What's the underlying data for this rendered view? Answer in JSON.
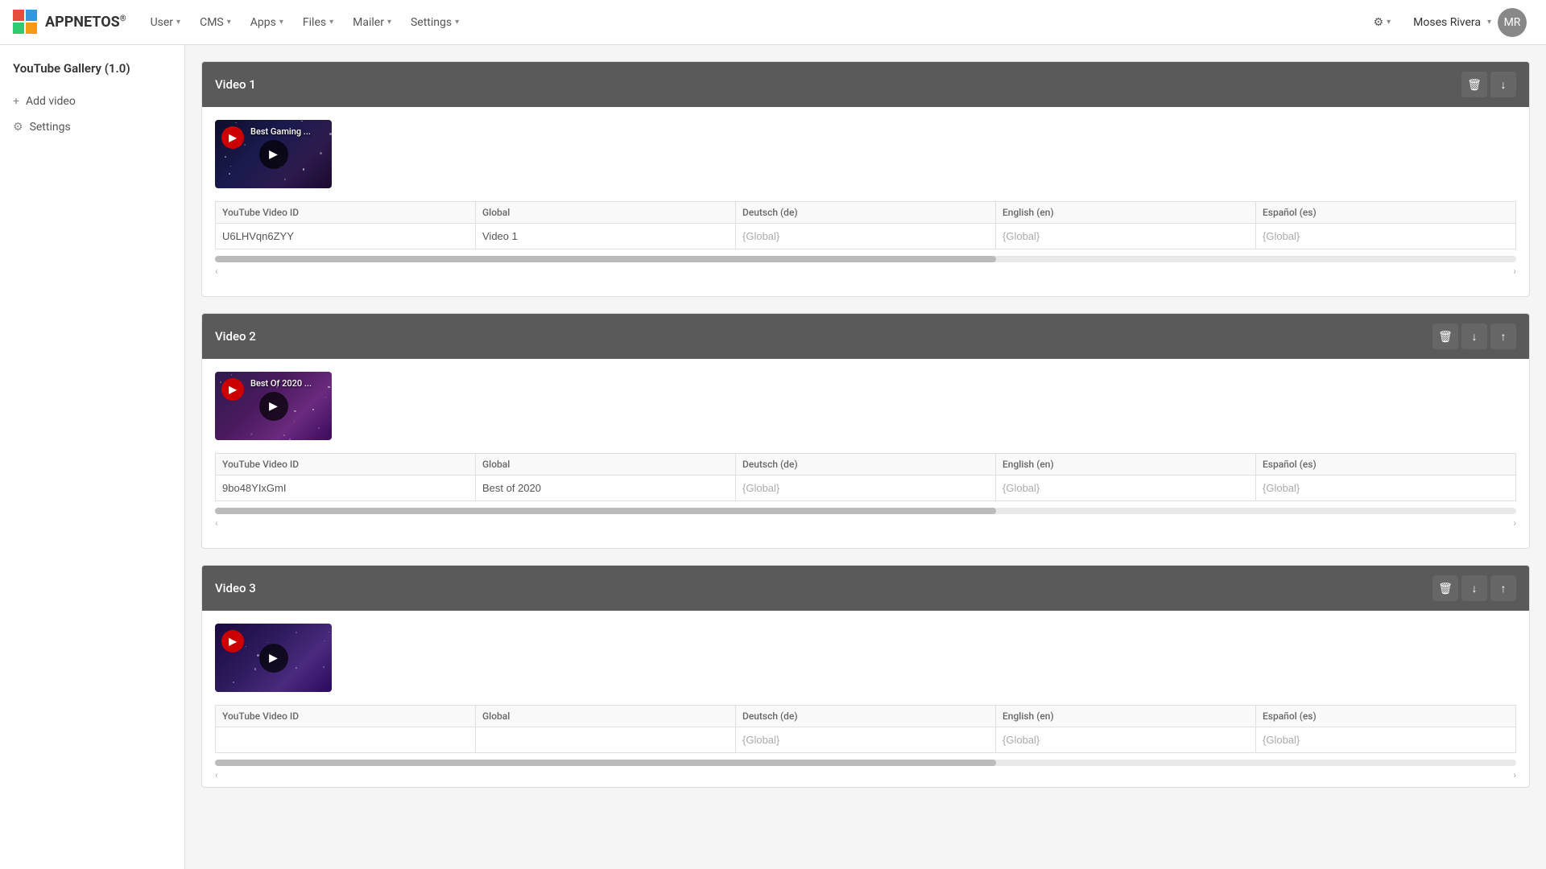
{
  "brand": {
    "name": "APPNETOS",
    "registered": "®"
  },
  "navbar": {
    "menu_items": [
      {
        "label": "User",
        "id": "user"
      },
      {
        "label": "CMS",
        "id": "cms"
      },
      {
        "label": "Apps",
        "id": "apps"
      },
      {
        "label": "Files",
        "id": "files"
      },
      {
        "label": "Mailer",
        "id": "mailer"
      },
      {
        "label": "Settings",
        "id": "settings"
      }
    ],
    "user_name": "Moses Rivera",
    "settings_icon": "⚙"
  },
  "sidebar": {
    "title": "YouTube Gallery (1.0)",
    "items": [
      {
        "label": "Add video",
        "icon": "+",
        "id": "add-video"
      },
      {
        "label": "Settings",
        "icon": "⚙",
        "id": "settings"
      }
    ]
  },
  "videos": [
    {
      "id": "video-1",
      "section_label": "Video 1",
      "thumbnail_label": "Best Gaming ...",
      "youtube_id": "U6LHVqn6ZYY",
      "global_value": "Video 1",
      "deutsch_value": "{Global}",
      "english_value": "{Global}",
      "espanol_value": "{Global}",
      "thumb_class": "thumb-bg-1",
      "has_up": false,
      "has_down": true
    },
    {
      "id": "video-2",
      "section_label": "Video 2",
      "thumbnail_label": "Best Of 2020 ...",
      "youtube_id": "9bo48YIxGmI",
      "global_value": "Best of 2020",
      "deutsch_value": "{Global}",
      "english_value": "{Global}",
      "espanol_value": "{Global}",
      "thumb_class": "thumb-bg-2",
      "has_up": true,
      "has_down": true
    },
    {
      "id": "video-3",
      "section_label": "Video 3",
      "thumbnail_label": "",
      "youtube_id": "",
      "global_value": "",
      "deutsch_value": "{Global}",
      "english_value": "{Global}",
      "espanol_value": "{Global}",
      "thumb_class": "thumb-bg-3",
      "has_up": true,
      "has_down": true
    }
  ],
  "table_headers": {
    "youtube_video_id": "YouTube Video ID",
    "global": "Global",
    "deutsch": "Deutsch (de)",
    "english": "English (en)",
    "espanol": "Español (es)"
  },
  "scroll_label_left": "‹",
  "scroll_label_right": "›",
  "icons": {
    "delete": "🗑",
    "down": "↓",
    "up": "↑",
    "play": "▶",
    "youtube": "▶",
    "caret": "▾",
    "plus": "+",
    "gear": "⚙"
  }
}
